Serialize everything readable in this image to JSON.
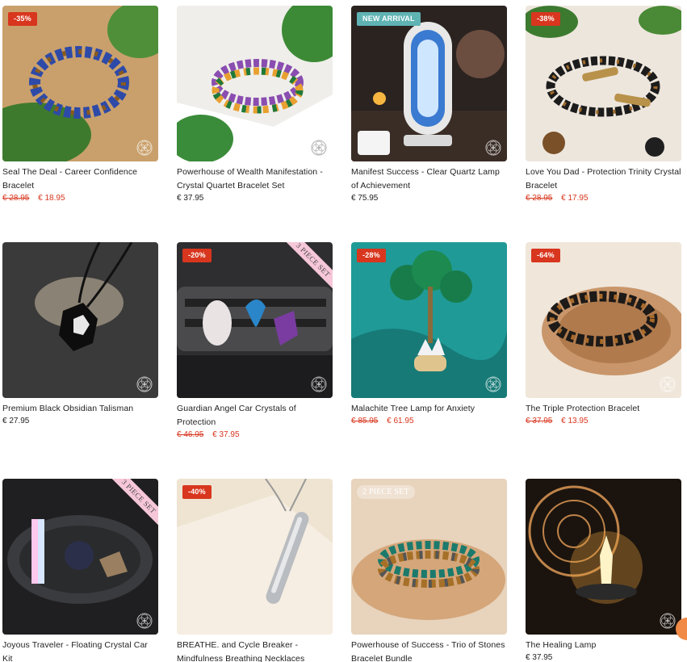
{
  "products": [
    {
      "title": "Seal The Deal - Career Confidence Bracelet",
      "badge": "-35%",
      "old_price": "€ 28.95",
      "price": "€ 18.95"
    },
    {
      "title": "Powerhouse of Wealth Manifestation - Crystal Quartet Bracelet Set",
      "badge": "",
      "old_price": "",
      "price": "€ 37.95"
    },
    {
      "title": "Manifest Success - Clear Quartz Lamp of Achievement",
      "badge": "NEW ARRIVAL",
      "old_price": "",
      "price": "€ 75.95"
    },
    {
      "title": "Love You Dad - Protection Trinity Crystal Bracelet",
      "badge": "-38%",
      "old_price": "€ 28.95",
      "price": "€ 17.95"
    },
    {
      "title": "Premium Black Obsidian Talisman",
      "badge": "",
      "old_price": "",
      "price": "€ 27.95"
    },
    {
      "title": "Guardian Angel Car Crystals of Protection",
      "badge": "-20%",
      "ribbon": "3 PIECE SET",
      "old_price": "€ 46.95",
      "price": "€ 37.95"
    },
    {
      "title": "Malachite Tree Lamp for Anxiety",
      "badge": "-28%",
      "old_price": "€ 85.95",
      "price": "€ 61.95"
    },
    {
      "title": "The Triple Protection Bracelet",
      "badge": "-64%",
      "old_price": "€ 37.95",
      "price": "€ 13.95"
    },
    {
      "title": "Joyous Traveler - Floating Crystal Car Kit",
      "badge": "",
      "ribbon": "3 PIECE SET",
      "old_price": "",
      "price": ""
    },
    {
      "title": "BREATHE. and Cycle Breaker - Mindfulness Breathing Necklaces",
      "badge": "-40%",
      "old_price": "",
      "price": ""
    },
    {
      "title": "Powerhouse of Success - Trio of Stones Bracelet Bundle",
      "badge": "2 PIECE SET",
      "old_price": "",
      "price": ""
    },
    {
      "title": "The Healing Lamp",
      "badge": "",
      "old_price": "",
      "price": "€ 37.95"
    }
  ],
  "colors": {
    "sale": "#d8361e",
    "new_arrival": "#5fb3b3",
    "ribbon": "#f6c7d8"
  },
  "icons": {
    "seal": "flower-of-life-icon",
    "chat": "help-chat-icon"
  }
}
